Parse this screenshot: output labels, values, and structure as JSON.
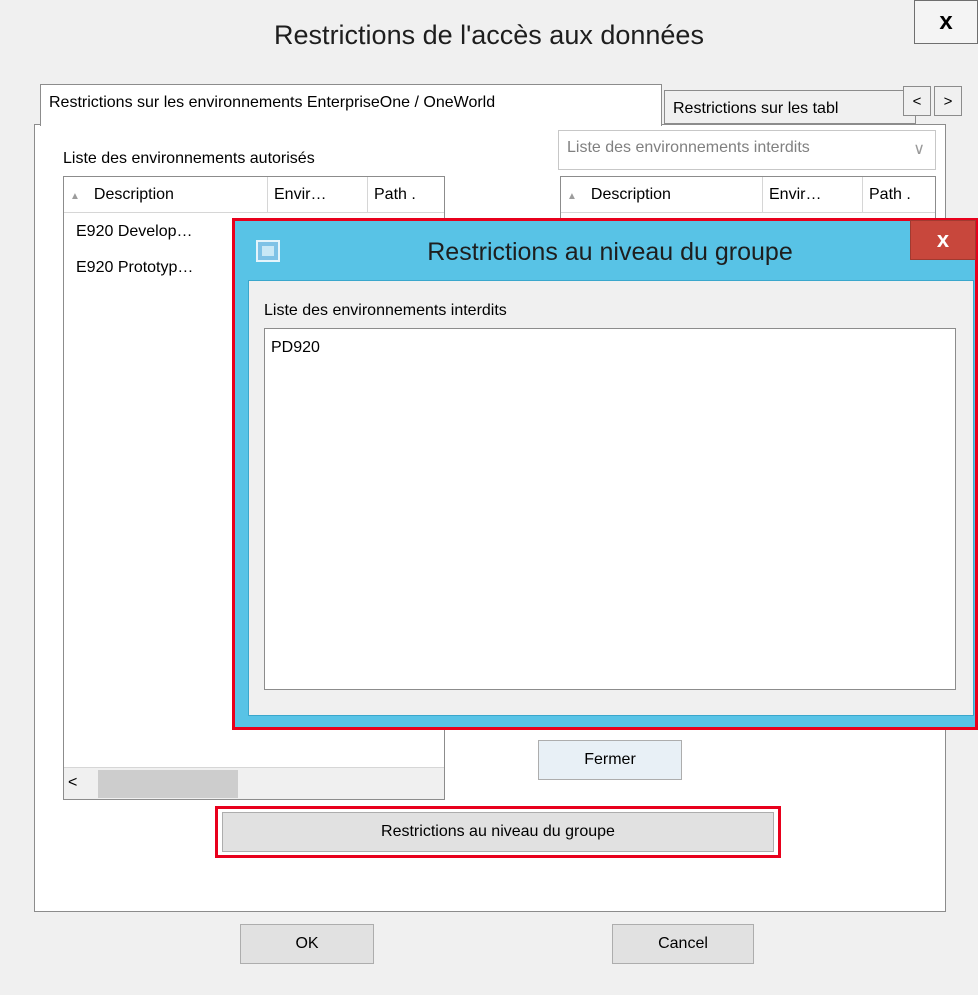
{
  "window": {
    "title": "Restrictions de l'accès aux données",
    "close_glyph": "x"
  },
  "tabs": {
    "env_label": "Restrictions sur les environnements EnterpriseOne / OneWorld",
    "tables_label": "Restrictions sur les tabl",
    "scroll_left": "<",
    "scroll_right": ">"
  },
  "allowed": {
    "label": "Liste des environnements autorisés",
    "columns": [
      "Description",
      "Envir…",
      "Path ."
    ],
    "rows": [
      "E920 Develop…",
      "E920 Prototyp…"
    ],
    "hscroll_left": "<"
  },
  "forbidden": {
    "combo_placeholder": "Liste des environnements interdits",
    "columns": [
      "Description",
      "Envir…",
      "Path ."
    ]
  },
  "buttons": {
    "group": "Restrictions au niveau du groupe",
    "ok": "OK",
    "cancel": "Cancel"
  },
  "popup": {
    "title": "Restrictions au niveau du groupe",
    "close_glyph": "x",
    "list_label": "Liste des environnements interdits",
    "items": [
      "PD920"
    ],
    "close_button": "Fermer"
  },
  "colors": {
    "highlight": "#e8001c",
    "popup_titlebar": "#58c3e6",
    "popup_close": "#c8473c"
  }
}
